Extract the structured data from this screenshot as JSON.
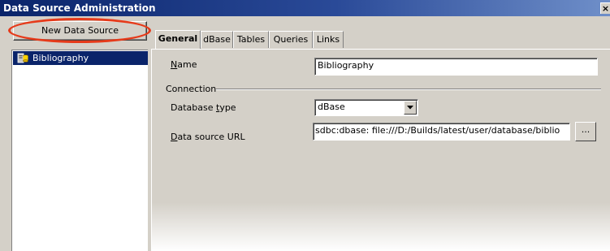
{
  "window": {
    "title": "Data Source Administration",
    "close_glyph": "×"
  },
  "sidebar": {
    "new_button_label": "New Data Source",
    "items": [
      {
        "label": "Bibliography",
        "icon": "database-icon"
      }
    ]
  },
  "tabs": [
    {
      "label": "General",
      "active": true
    },
    {
      "label": "dBase",
      "active": false
    },
    {
      "label": "Tables",
      "active": false
    },
    {
      "label": "Queries",
      "active": false
    },
    {
      "label": "Links",
      "active": false
    }
  ],
  "general": {
    "name_label_pre": "",
    "name_label_mn": "N",
    "name_label_post": "ame",
    "name_value": "Bibliography",
    "connection_heading": "Connection",
    "dbtype_label_pre": "Database ",
    "dbtype_label_mn": "t",
    "dbtype_label_post": "ype",
    "dbtype_value": "dBase",
    "url_label_pre": "",
    "url_label_mn": "D",
    "url_label_post": "ata source URL",
    "url_prefix": "sdbc:dbase:",
    "url_value": "file:///D:/Builds/latest/user/database/biblio",
    "browse_label": "..."
  },
  "colors": {
    "highlight_oval": "#e63a1a",
    "selection": "#0a246a",
    "titlebar": "#0a246a"
  }
}
